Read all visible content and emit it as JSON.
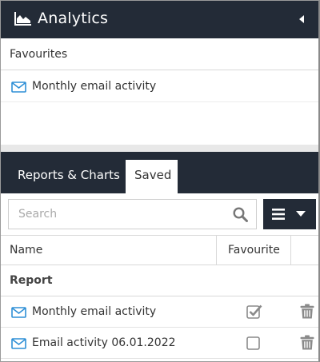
{
  "header": {
    "title": "Analytics",
    "icon": "area-chart-icon",
    "collapse_icon": "caret-left-icon",
    "background": "#232b37"
  },
  "favourites": {
    "heading": "Favourites",
    "items": [
      {
        "label": "Monthly email activity",
        "icon": "envelope-icon"
      }
    ]
  },
  "tabs": [
    {
      "label": "Reports & Charts",
      "active": false
    },
    {
      "label": "Saved",
      "active": true
    }
  ],
  "search": {
    "placeholder": "Search",
    "value": "",
    "icon": "search-icon"
  },
  "menu_button": {
    "icons": [
      "bars-icon",
      "caret-down-icon"
    ]
  },
  "table": {
    "columns": [
      "Name",
      "Favourite"
    ],
    "group": "Report",
    "rows": [
      {
        "name": "Monthly email activity",
        "favourite": true,
        "icon": "envelope-icon"
      },
      {
        "name": "Email activity 06.01.2022",
        "favourite": false,
        "icon": "envelope-icon"
      }
    ]
  },
  "colors": {
    "accent_blue": "#2e8fd6",
    "dark_bar": "#232b37",
    "icon_gray": "#8a8a8a"
  }
}
